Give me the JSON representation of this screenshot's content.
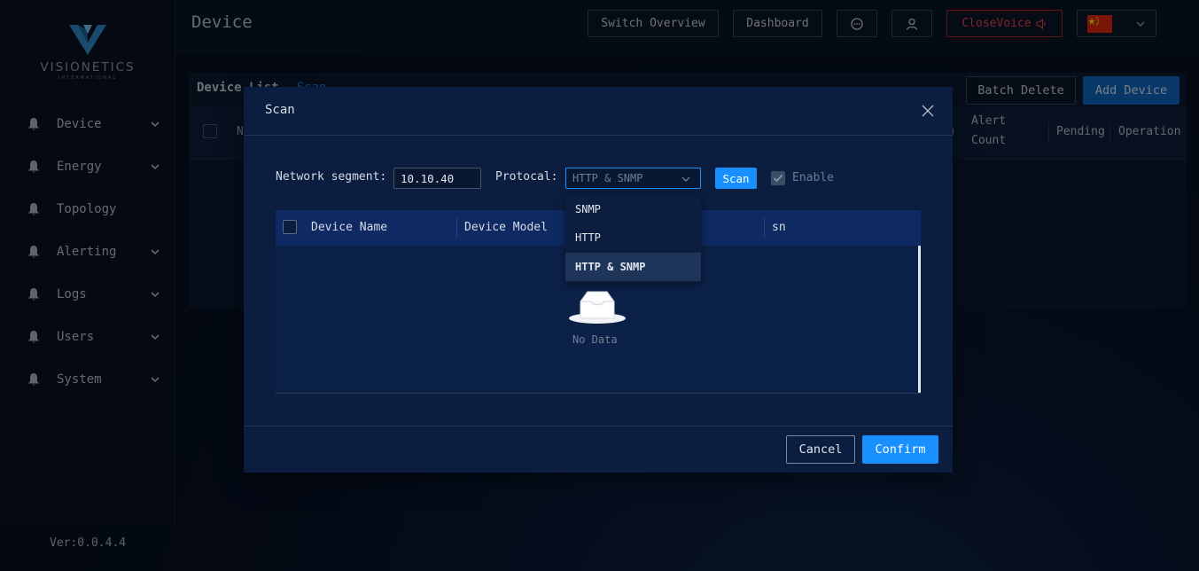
{
  "app": {
    "logo_text": "VISIONETICS",
    "logo_sub": "INTERNATIONAL",
    "version": "Ver:0.0.4.4"
  },
  "sidebar": {
    "items": [
      {
        "label": "Device",
        "icon": "bell-icon",
        "expandable": true
      },
      {
        "label": "Energy",
        "icon": "bell-icon",
        "expandable": true
      },
      {
        "label": "Topology",
        "icon": "bell-icon",
        "expandable": false
      },
      {
        "label": "Alerting",
        "icon": "bell-icon",
        "expandable": true
      },
      {
        "label": "Logs",
        "icon": "bell-icon",
        "expandable": true
      },
      {
        "label": "Users",
        "icon": "bell-icon",
        "expandable": true
      },
      {
        "label": "System",
        "icon": "bell-icon",
        "expandable": true
      }
    ]
  },
  "header": {
    "title": "Device",
    "switch_overview": "Switch Overview",
    "dashboard": "Dashboard",
    "close_voice": "CloseVoice",
    "language_flag": "flag-cn-icon"
  },
  "page": {
    "list_title": "Device List",
    "scan_link": "Scan",
    "batch_delete": "Batch Delete",
    "add_device": "Add Device",
    "columns": {
      "n": "N",
      "paren": ")",
      "alert_line1": "Alert",
      "alert_line2": "Count",
      "pending": "Pending",
      "operation": "Operation"
    }
  },
  "modal": {
    "title": "Scan",
    "network_segment_label": "Network segment:",
    "network_segment_value": "10.10.40",
    "protocol_label": "Protocal:",
    "protocol_value": "HTTP & SNMP",
    "scan_button": "Scan",
    "enable_label": "Enable",
    "enable_checked": true,
    "table_headers": [
      "Device Name",
      "Device Model",
      "",
      "sn"
    ],
    "empty_text": "No Data",
    "cancel": "Cancel",
    "confirm": "Confirm"
  },
  "protocol_dropdown": {
    "options": [
      "SNMP",
      "HTTP",
      "HTTP & SNMP"
    ],
    "selected": "HTTP & SNMP"
  },
  "colors": {
    "accent": "#1890ff",
    "danger": "#e8464c",
    "modal_bg": "#0b1e3f"
  }
}
